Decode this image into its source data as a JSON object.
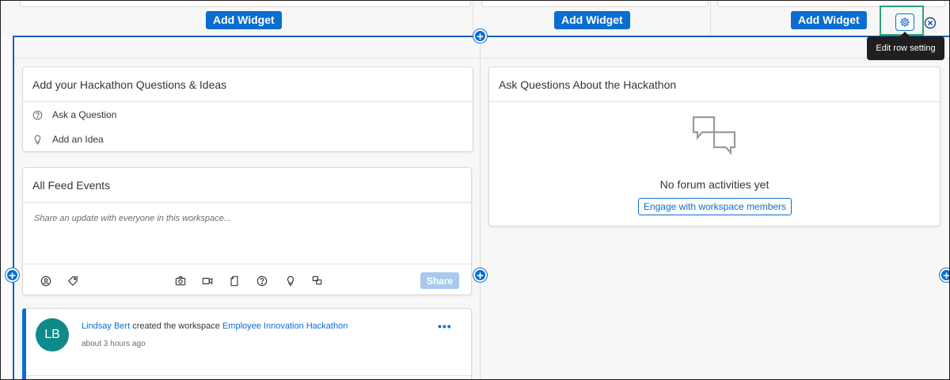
{
  "top_row": {
    "add_widget_labels": [
      "Add Widget",
      "Add Widget",
      "Add Widget"
    ]
  },
  "row_toolbar": {
    "settings_icon": "gear-icon",
    "close_icon": "close-circle-icon",
    "tooltip": "Edit row setting",
    "highlight_color": "#2aa37a"
  },
  "left_column": {
    "ideas_card": {
      "title": "Add your Hackathon Questions & Ideas",
      "items": [
        {
          "label": "Ask a Question",
          "icon": "question-circle-icon"
        },
        {
          "label": "Add an Idea",
          "icon": "lightbulb-icon"
        }
      ]
    },
    "feed_card": {
      "title": "All Feed Events",
      "placeholder": "Share an update with everyone in this workspace...",
      "tools": [
        "mention-icon",
        "tag-icon",
        "camera-icon",
        "video-icon",
        "document-icon",
        "question-circle-icon",
        "lightbulb-icon",
        "discussion-icon"
      ],
      "share_label": "Share"
    },
    "feed_item": {
      "avatar_initials": "LB",
      "author": "Lindsay Bert",
      "action": " created the workspace ",
      "target": "Employee Innovation Hackathon",
      "time": "about 3 hours ago",
      "more": "•••"
    }
  },
  "right_column": {
    "forum_card": {
      "title": "Ask Questions About the Hackathon",
      "empty_message": "No forum activities yet",
      "engage_label": "Engage with workspace members",
      "empty_icon": "chat-bubbles-icon"
    }
  },
  "colors": {
    "accent": "#0a6ed1",
    "avatar": "#0f8a8a",
    "selection_border": "#1a5fb4"
  }
}
